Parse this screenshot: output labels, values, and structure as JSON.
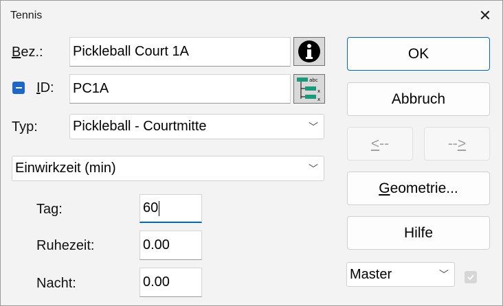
{
  "window": {
    "title": "Tennis"
  },
  "form": {
    "bez_label_u": "B",
    "bez_label_rest": "ez.:",
    "bez_value": "Pickleball Court 1A",
    "id_label_u": "I",
    "id_label_rest": "D:",
    "id_value": "PC1A",
    "typ_label": "Typ:",
    "typ_value": "Pickleball - Courtmitte",
    "mode_value": "Einwirkzeit (min)",
    "tag_label": "Tag:",
    "tag_value": "60",
    "ruhezeit_label": "Ruhezeit:",
    "ruhezeit_value": "0.00",
    "nacht_label": "Nacht:",
    "nacht_value": "0.00"
  },
  "buttons": {
    "ok": "OK",
    "abbruch": "Abbruch",
    "prev_u": "<",
    "prev_rest": "--",
    "next_rest": "--",
    "next_u": ">",
    "geometrie_u": "G",
    "geometrie_rest": "eometrie...",
    "hilfe": "Hilfe"
  },
  "master": {
    "value": "Master"
  },
  "icons": {
    "info": "info-icon",
    "tree": "tree-structure-icon",
    "close": "close-icon",
    "collapse": "minus-toggle-icon"
  },
  "colors": {
    "accent": "#0067c0"
  }
}
